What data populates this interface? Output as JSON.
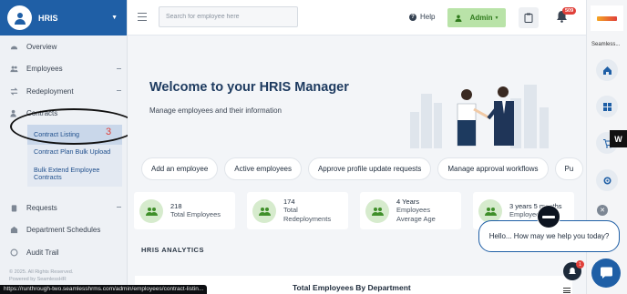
{
  "brand": {
    "name": "HRIS"
  },
  "sidebar": {
    "items": [
      {
        "label": "Overview"
      },
      {
        "label": "Employees"
      },
      {
        "label": "Redeployment"
      },
      {
        "label": "Contracts"
      },
      {
        "label": "Requests"
      },
      {
        "label": "Department Schedules"
      },
      {
        "label": "Audit Trail"
      }
    ],
    "sub_items": [
      {
        "label": "Contract Listing"
      },
      {
        "label": "Contract Plan Bulk Upload"
      },
      {
        "label": "Bulk Extend Employee Contracts"
      }
    ],
    "annotation_number": "3",
    "copyright_line1": "© 2025. All Rights Reserved.",
    "copyright_line2": "Powered by SeamlessHR"
  },
  "topbar": {
    "search_placeholder": "Search for employee here",
    "help_label": "Help",
    "admin_label": "Admin",
    "notification_count": "509"
  },
  "hero": {
    "title": "Welcome to your HRIS Manager",
    "subtitle": "Manage employees and their information"
  },
  "quick_actions": [
    {
      "label": "Add an employee"
    },
    {
      "label": "Active employees"
    },
    {
      "label": "Approve profile update requests"
    },
    {
      "label": "Manage approval workflows"
    },
    {
      "label": "Pu"
    }
  ],
  "stats": [
    {
      "value": "218",
      "label": "Total Employees"
    },
    {
      "value": "174",
      "label": "Total Redeployments"
    },
    {
      "value": "4 Years",
      "label": "Employees Average Age"
    },
    {
      "value": "3 years 5 months",
      "label": "Employees"
    }
  ],
  "analytics": {
    "heading": "HRIS ANALYTICS",
    "chart_title": "Total Employees By Department"
  },
  "rail": {
    "name": "Seamless..."
  },
  "chat": {
    "greeting": "Hello... How may we help you today?",
    "badge": "1"
  },
  "status_url": "https://runthrough-two.seamlesshrms.com/admin/employees/contract-listin...",
  "colors": {
    "brand": "#1f5fa6",
    "admin_bg": "#b9e3a8",
    "badge": "#e0403a",
    "stat_icon_bg": "#d6ebcd"
  }
}
